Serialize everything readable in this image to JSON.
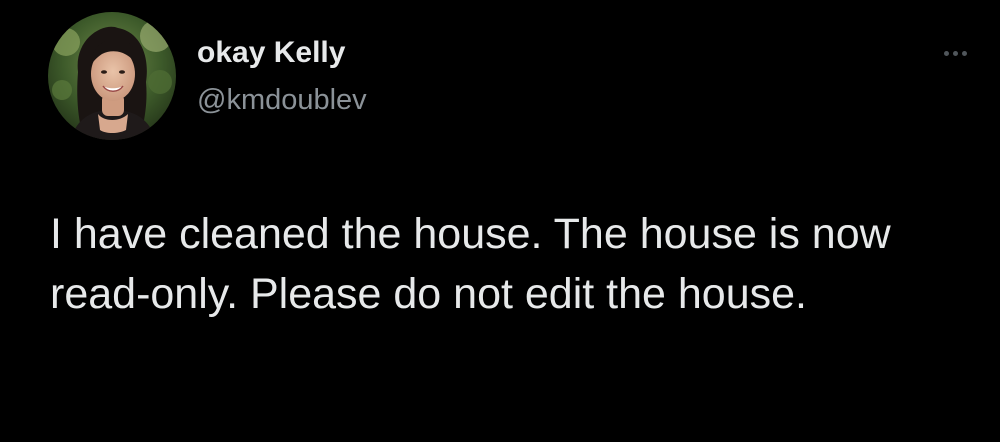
{
  "tweet": {
    "author": {
      "display_name": "okay Kelly",
      "handle": "@kmdoublev"
    },
    "text": "I have cleaned the house. The house is now read-only. Please do not edit the house.",
    "more_icon": "more-horizontal-icon"
  },
  "colors": {
    "background": "#000000",
    "primary_text": "#e7e9ea",
    "secondary_text": "#8b9298",
    "icon_gray": "#50565b"
  }
}
